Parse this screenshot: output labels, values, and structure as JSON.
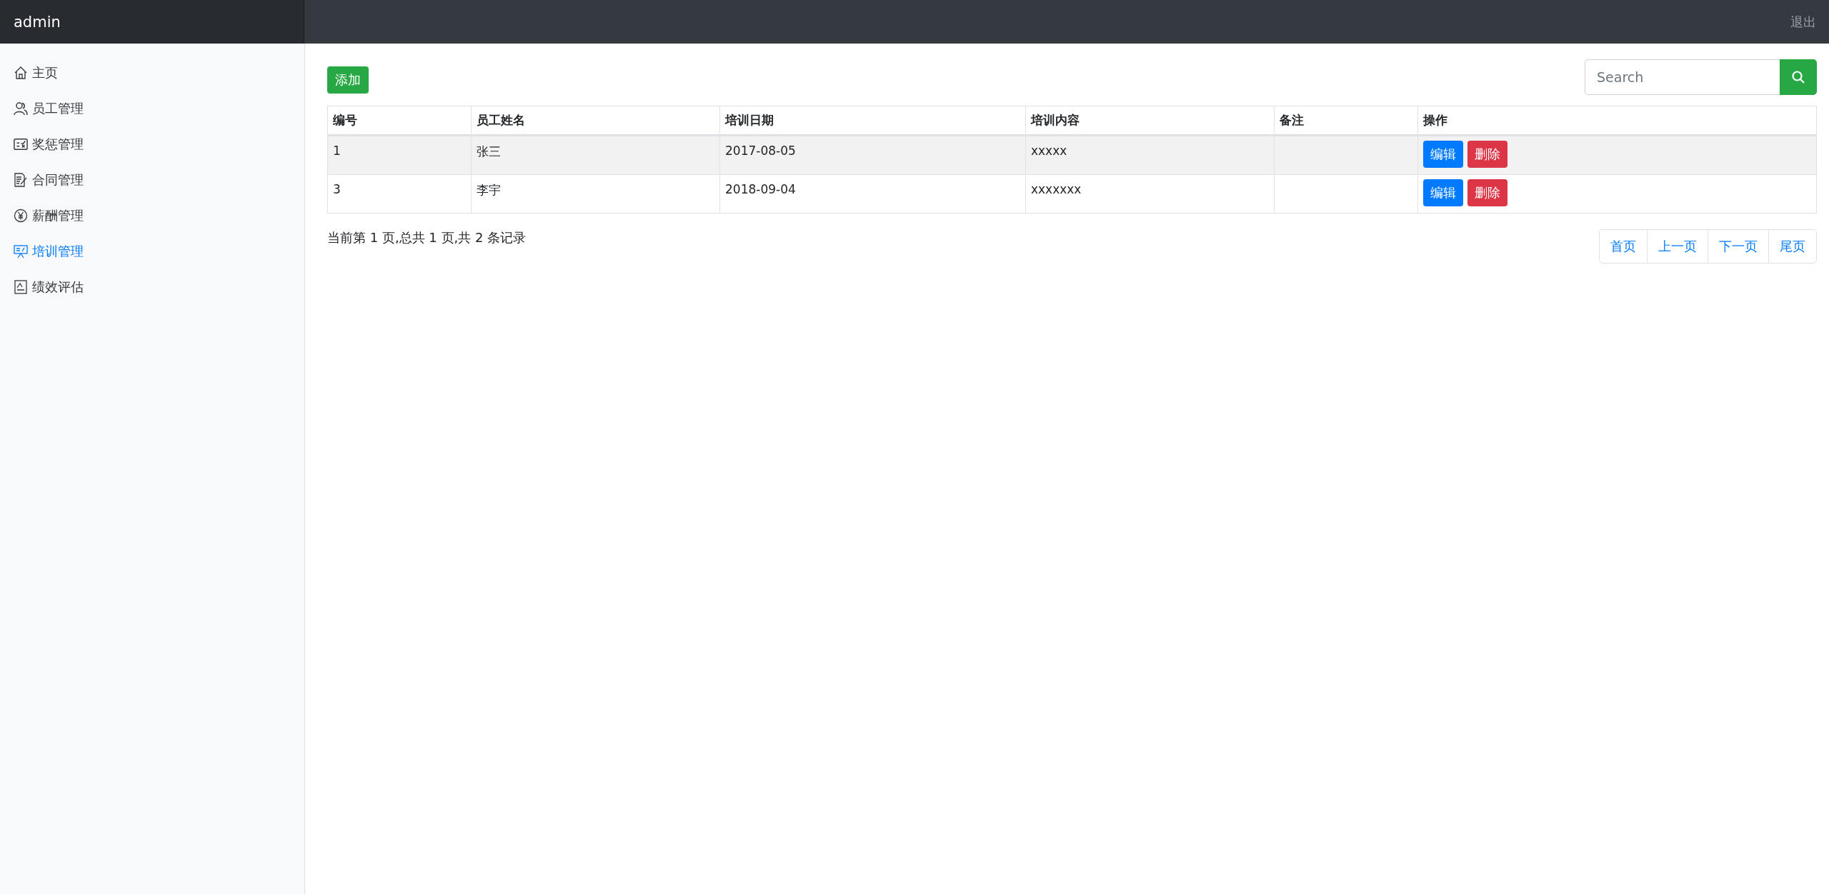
{
  "topbar": {
    "brand": "admin",
    "logout": "退出"
  },
  "sidebar": {
    "items": [
      {
        "label": "主页",
        "selected": false
      },
      {
        "label": "员工管理",
        "selected": false
      },
      {
        "label": "奖惩管理",
        "selected": false
      },
      {
        "label": "合同管理",
        "selected": false
      },
      {
        "label": "薪酬管理",
        "selected": false
      },
      {
        "label": "培训管理",
        "selected": true
      },
      {
        "label": "绩效评估",
        "selected": false
      }
    ]
  },
  "toolbar": {
    "add_button": "添加",
    "search": {
      "placeholder": "Search"
    }
  },
  "table": {
    "columns": [
      "编号",
      "员工姓名",
      "培训日期",
      "培训内容",
      "备注",
      "操作"
    ],
    "rows": [
      {
        "highlighted": true,
        "cells": [
          "1",
          "张三",
          "2017-08-05",
          "xxxxx",
          ""
        ],
        "actions": [
          "编辑",
          "删除"
        ]
      },
      {
        "highlighted": false,
        "cells": [
          "3",
          "李宇",
          "2018-09-04",
          "xxxxxxx",
          ""
        ],
        "actions": [
          "编辑",
          "删除"
        ]
      }
    ]
  },
  "summary": "当前第 1 页,总共 1 页,共 2 条记录",
  "pagination": [
    "首页",
    "上一页",
    "下一页",
    "尾页"
  ]
}
